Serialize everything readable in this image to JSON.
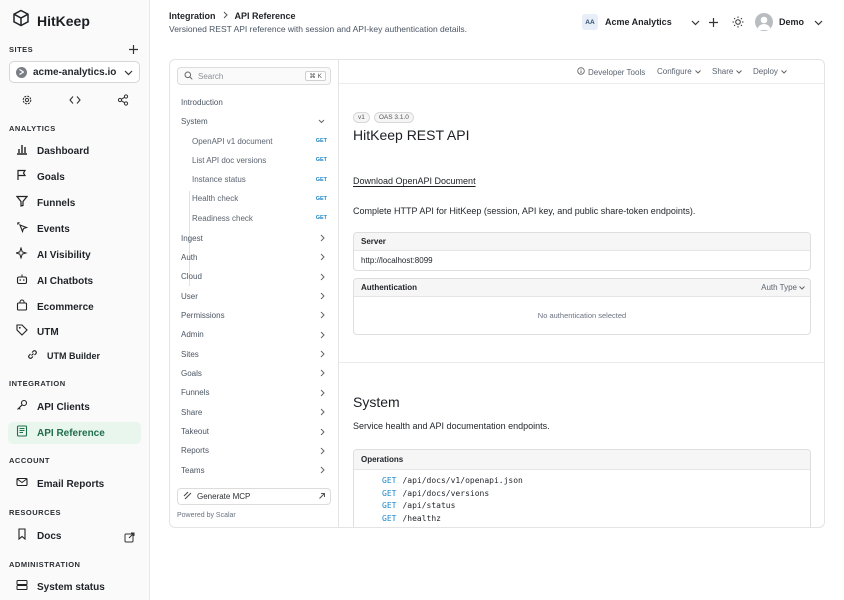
{
  "app": {
    "brand": "HitKeep"
  },
  "sidebar": {
    "sites_label": "SITES",
    "site": "acme-analytics.io",
    "sections": {
      "analytics": "ANALYTICS",
      "integration": "INTEGRATION",
      "account": "ACCOUNT",
      "resources": "RESOURCES",
      "administration": "ADMINISTRATION"
    },
    "items": {
      "dashboard": "Dashboard",
      "goals": "Goals",
      "funnels": "Funnels",
      "events": "Events",
      "ai_visibility": "AI Visibility",
      "ai_chatbots": "AI Chatbots",
      "ecommerce": "Ecommerce",
      "utm": "UTM",
      "utm_builder": "UTM Builder",
      "api_clients": "API Clients",
      "api_reference": "API Reference",
      "email_reports": "Email Reports",
      "docs": "Docs",
      "system_status": "System status"
    }
  },
  "header": {
    "breadcrumb": [
      "Integration",
      "API Reference"
    ],
    "subtitle": "Versioned REST API reference with session and API-key authentication details.",
    "org_initials": "AA",
    "org_name": "Acme Analytics",
    "user_name": "Demo"
  },
  "docs": {
    "search_placeholder": "Search",
    "search_shortcut": "⌘ K",
    "nav": {
      "introduction": "Introduction",
      "system": "System",
      "endpoints": [
        {
          "label": "OpenAPI v1 document",
          "method": "GET"
        },
        {
          "label": "List API doc versions",
          "method": "GET"
        },
        {
          "label": "Instance status",
          "method": "GET"
        },
        {
          "label": "Health check",
          "method": "GET"
        },
        {
          "label": "Readiness check",
          "method": "GET"
        }
      ],
      "groups": [
        "Ingest",
        "Auth",
        "Cloud",
        "User",
        "Permissions",
        "Admin",
        "Sites",
        "Goals",
        "Funnels",
        "Share",
        "Takeout",
        "Reports",
        "Teams"
      ]
    },
    "generate_mcp": "Generate MCP",
    "powered_by": "Powered by Scalar",
    "toolbar": {
      "developer_tools": "Developer Tools",
      "configure": "Configure",
      "share": "Share",
      "deploy": "Deploy"
    },
    "version_badge": "v1",
    "oas_badge": "OAS 3.1.0",
    "title": "HitKeep REST API",
    "download": "Download OpenAPI Document",
    "description": "Complete HTTP API for HitKeep (session, API key, and public share-token endpoints).",
    "server_label": "Server",
    "server_url": "http://localhost:8099",
    "auth_label": "Authentication",
    "auth_type": "Auth Type",
    "auth_empty": "No authentication selected",
    "system_title": "System",
    "system_desc": "Service health and API documentation endpoints.",
    "operations_label": "Operations",
    "operations": [
      {
        "method": "GET",
        "path": "/api/docs/v1/openapi.json"
      },
      {
        "method": "GET",
        "path": "/api/docs/versions"
      },
      {
        "method": "GET",
        "path": "/api/status"
      },
      {
        "method": "GET",
        "path": "/healthz"
      }
    ]
  },
  "colors": {
    "accent": "#1f6f4a",
    "active_bg": "#e9f6ee",
    "method": "#1e88c9"
  }
}
